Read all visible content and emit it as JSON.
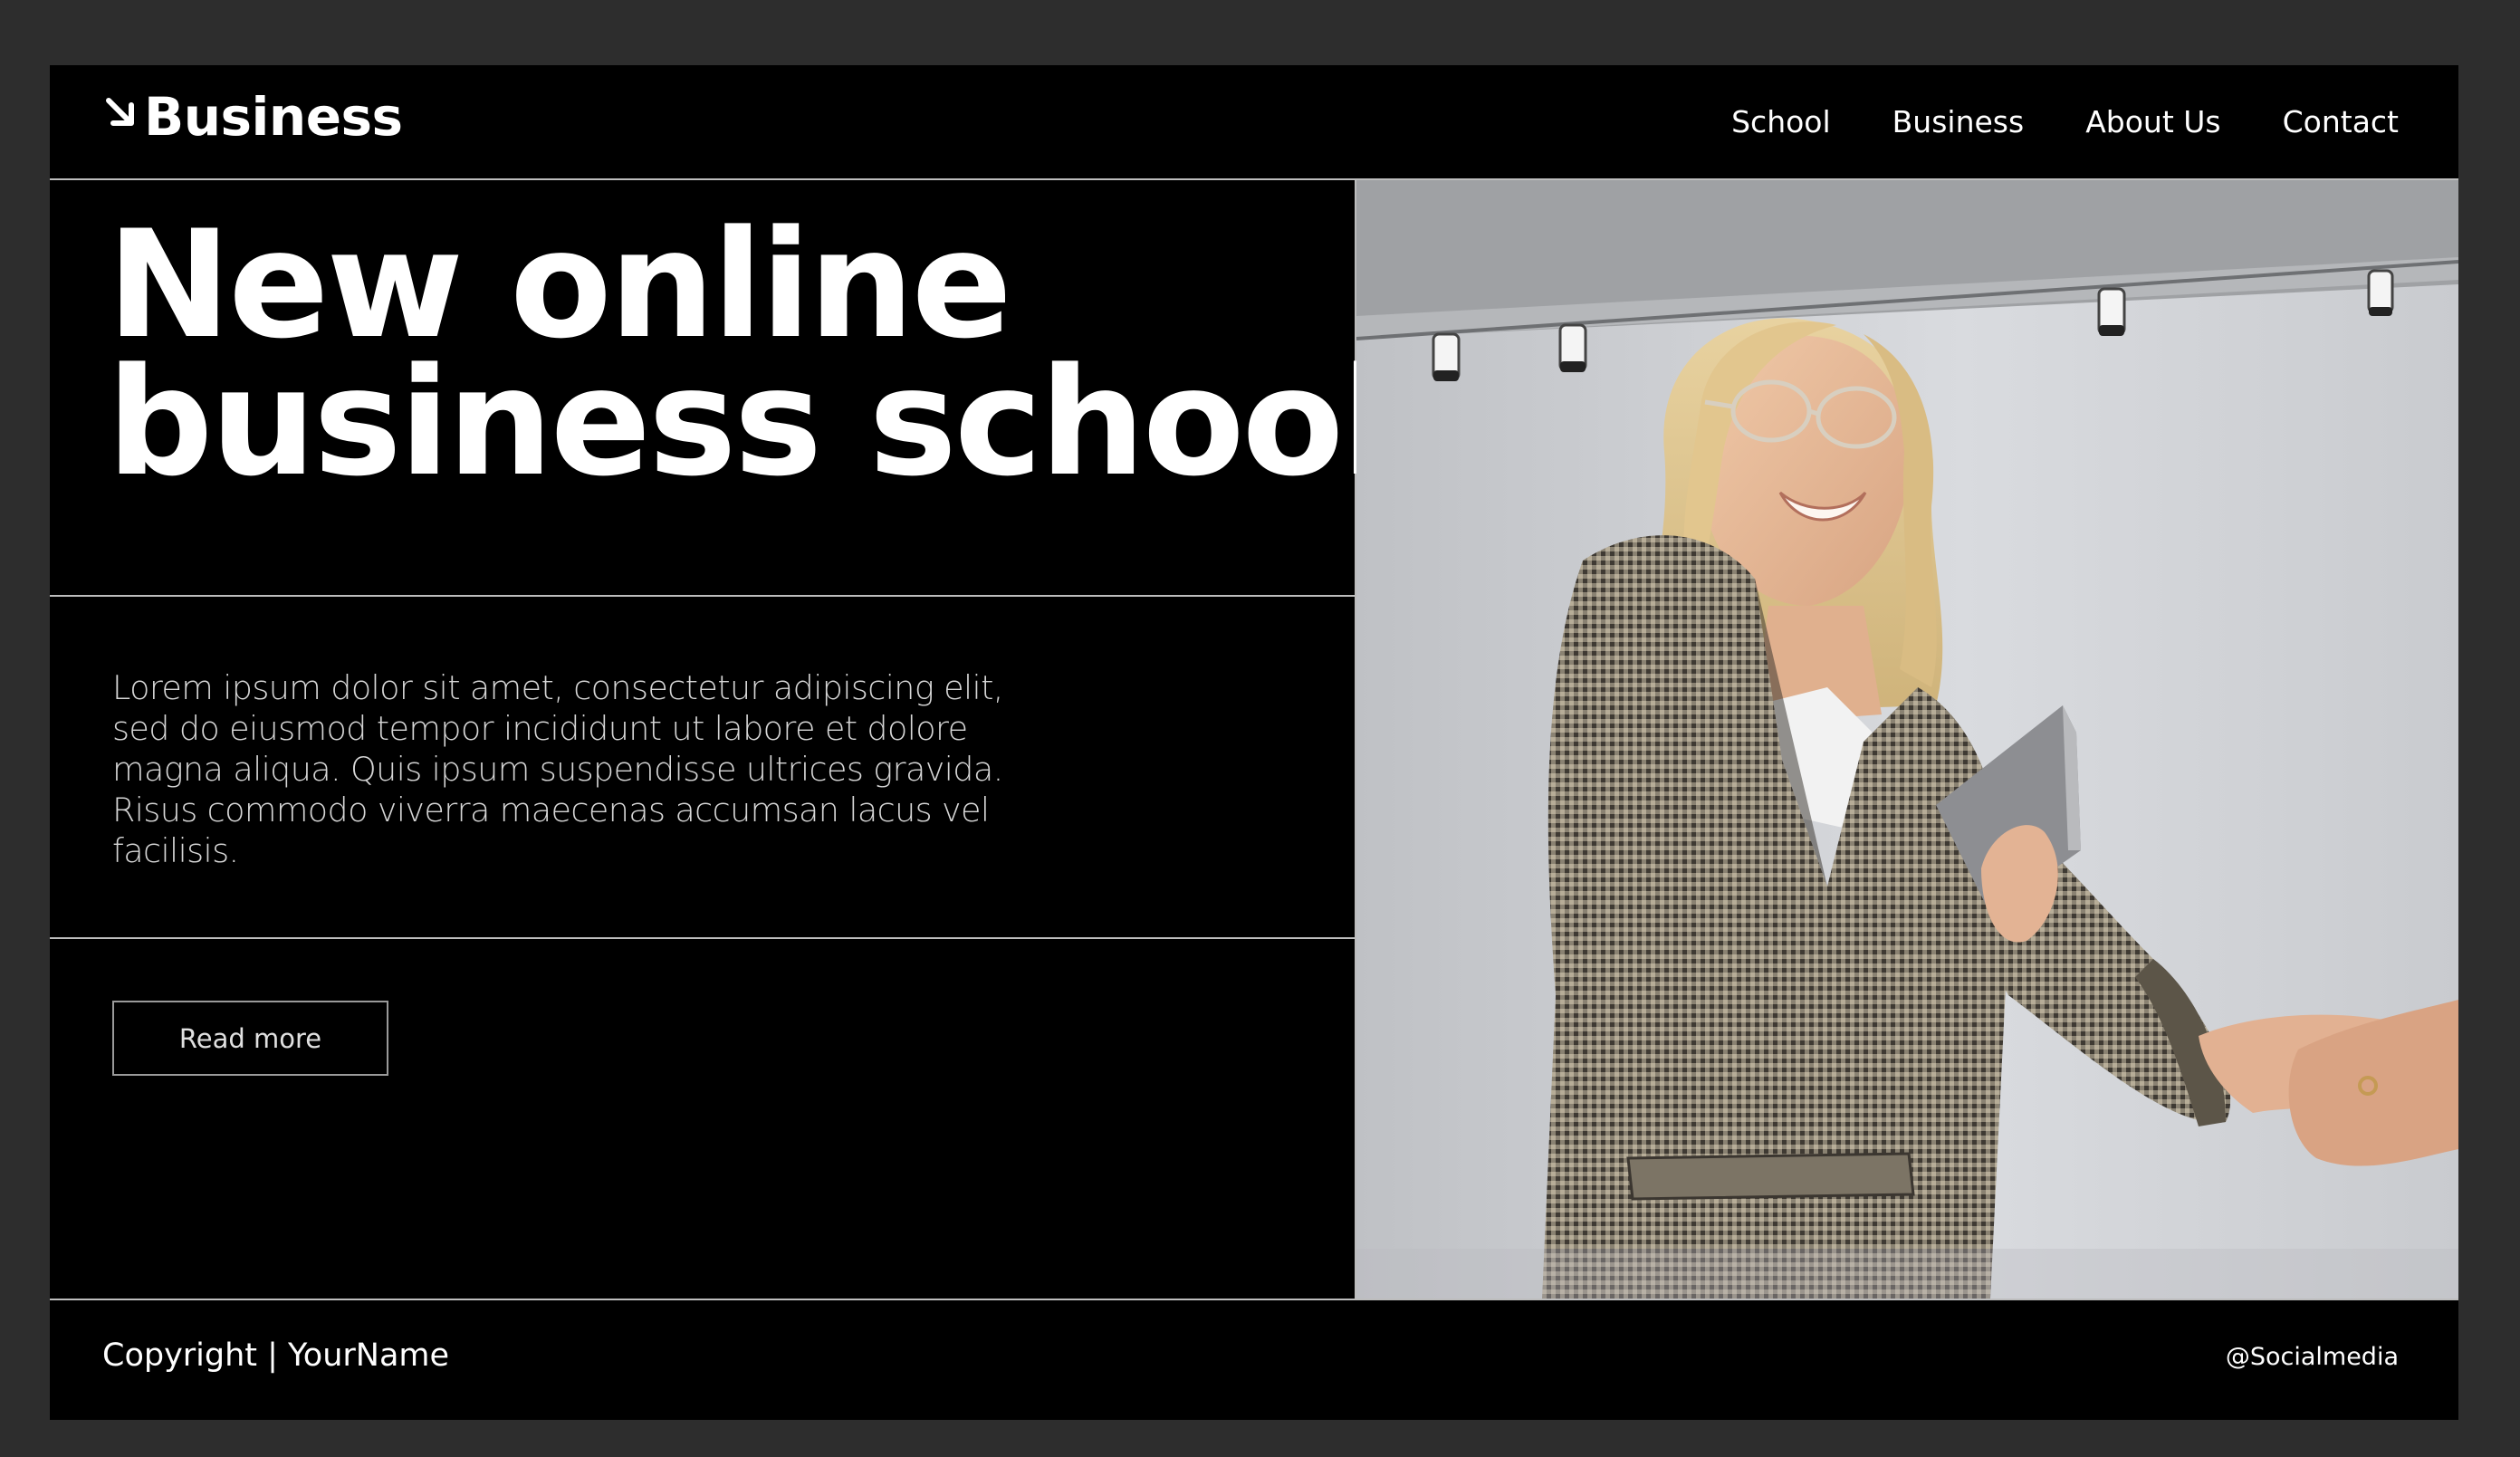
{
  "header": {
    "logo_text": "Business",
    "nav": [
      "School",
      "Business",
      "About Us",
      "Contact"
    ]
  },
  "hero": {
    "title_line1": "New online",
    "title_line2": "business school"
  },
  "description": "Lorem ipsum dolor sit amet, consectetur adipiscing elit, sed do eiusmod tempor incididunt ut labore et dolore magna aliqua. Quis ipsum suspendisse ultrices gravida. Risus commodo viverra maecenas accumsan lacus vel facilisis.",
  "cta": {
    "read_more_label": "Read more"
  },
  "footer": {
    "copyright": "Copyright | YourName",
    "social": "@Socialmedia"
  },
  "colors": {
    "background": "#000000",
    "text": "#ffffff",
    "divider": "#bdbdbd",
    "outer": "#2d2d2d"
  },
  "icons": {
    "logo": "arrow-down-right-icon"
  }
}
